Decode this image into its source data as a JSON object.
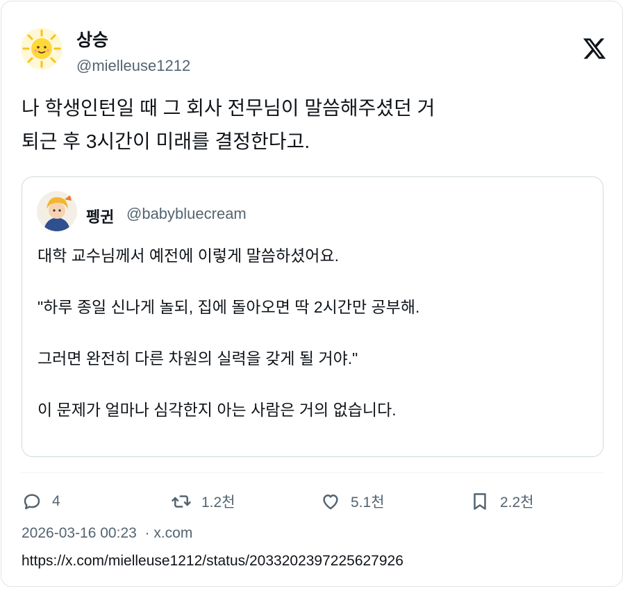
{
  "tweet": {
    "author_name": "상승",
    "author_handle": "@mielleuse1212",
    "text_lines": [
      "나 학생인턴일 때 그 회사 전무님이 말씀해주셨던 거",
      "퇴근 후 3시간이 미래를 결정한다고."
    ]
  },
  "quote": {
    "author_name": "펭귄",
    "author_handle": "@babybluecream",
    "paragraphs": [
      "대학 교수님께서 예전에 이렇게 말씀하셨어요.",
      "\"하루 종일 신나게 놀되, 집에 돌아오면 딱 2시간만 공부해.",
      "그러면 완전히 다른 차원의 실력을 갖게 될 거야.\"",
      "이 문제가 얼마나 심각한지 아는 사람은 거의 없습니다."
    ]
  },
  "actions": {
    "reply_count": "4",
    "retweet_count": "1.2천",
    "like_count": "5.1천",
    "bookmark_count": "2.2천"
  },
  "meta": {
    "timestamp": "2026-03-16 00:23",
    "separator": "·",
    "source": "x.com"
  },
  "url": "https://x.com/mielleuse1212/status/2033202397225627926",
  "icons": {
    "brand": "x-logo-icon",
    "reply": "reply-icon",
    "retweet": "retweet-icon",
    "like": "heart-icon",
    "bookmark": "bookmark-icon"
  },
  "colors": {
    "text": "#0f1419",
    "secondary": "#536471",
    "border": "#cfd9de"
  }
}
